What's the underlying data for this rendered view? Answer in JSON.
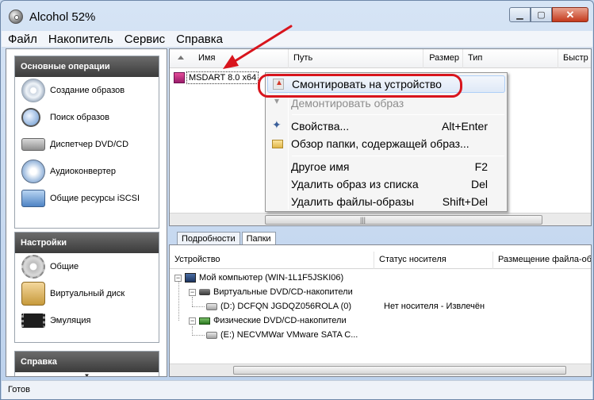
{
  "window": {
    "title": "Alcohol 52%"
  },
  "menubar": [
    "Файл",
    "Накопитель",
    "Сервис",
    "Справка"
  ],
  "left": {
    "main_ops": {
      "title": "Основные операции",
      "items": [
        {
          "label": "Создание образов",
          "icon": "disc-icon"
        },
        {
          "label": "Поиск образов",
          "icon": "search-icon"
        },
        {
          "label": "Диспетчер DVD/CD",
          "icon": "drive-icon"
        },
        {
          "label": "Аудиоконвертер",
          "icon": "audio-icon"
        },
        {
          "label": "Общие ресурсы iSCSI",
          "icon": "network-icon"
        }
      ]
    },
    "settings": {
      "title": "Настройки",
      "items": [
        {
          "label": "Общие",
          "icon": "gear-icon"
        },
        {
          "label": "Виртуальный диск",
          "icon": "virtual-disk-icon"
        },
        {
          "label": "Эмуляция",
          "icon": "chip-icon"
        }
      ]
    },
    "help": {
      "title": "Справка"
    }
  },
  "list": {
    "columns": [
      "Имя",
      "Путь",
      "Размер",
      "Тип",
      "Быстр"
    ],
    "files": [
      {
        "name": "MSDART 8.0 x64"
      }
    ]
  },
  "context_menu": {
    "items": [
      {
        "label": "Смонтировать на устройство",
        "key": "",
        "enabled": true,
        "highlighted": true,
        "icon": "mount-icon"
      },
      {
        "label": "Демонтировать образ",
        "key": "",
        "enabled": false,
        "icon": "unmount-icon"
      },
      {
        "label": "Свойства...",
        "key": "Alt+Enter",
        "enabled": true,
        "icon": "properties-icon"
      },
      {
        "label": "Обзор папки, содержащей образ...",
        "key": "",
        "enabled": true,
        "icon": "folder-icon"
      },
      {
        "label": "Другое имя",
        "key": "F2",
        "enabled": true
      },
      {
        "label": "Удалить образ из списка",
        "key": "Del",
        "enabled": true
      },
      {
        "label": "Удалить файлы-образы",
        "key": "Shift+Del",
        "enabled": true
      }
    ]
  },
  "tabs": [
    "Подробности",
    "Папки"
  ],
  "tree": {
    "columns": [
      "Устройство",
      "Статус носителя",
      "Размещение файла-об"
    ],
    "rows": [
      {
        "label": "Мой компьютер (WIN-1L1F5JSKI06)",
        "status": ""
      },
      {
        "label": "Виртуальные DVD/CD-накопители",
        "status": ""
      },
      {
        "label": "(D:) DCFQN JGDQZ056ROLA (0)",
        "status": "Нет носителя - Извлечён"
      },
      {
        "label": "Физические DVD/CD-накопители",
        "status": ""
      },
      {
        "label": "(E:) NECVMWar VMware SATA C...",
        "status": ""
      }
    ]
  },
  "status": {
    "text": "Готов"
  },
  "accent": {
    "highlight": "#d8151d",
    "header_dark": "#3b3b3b"
  }
}
